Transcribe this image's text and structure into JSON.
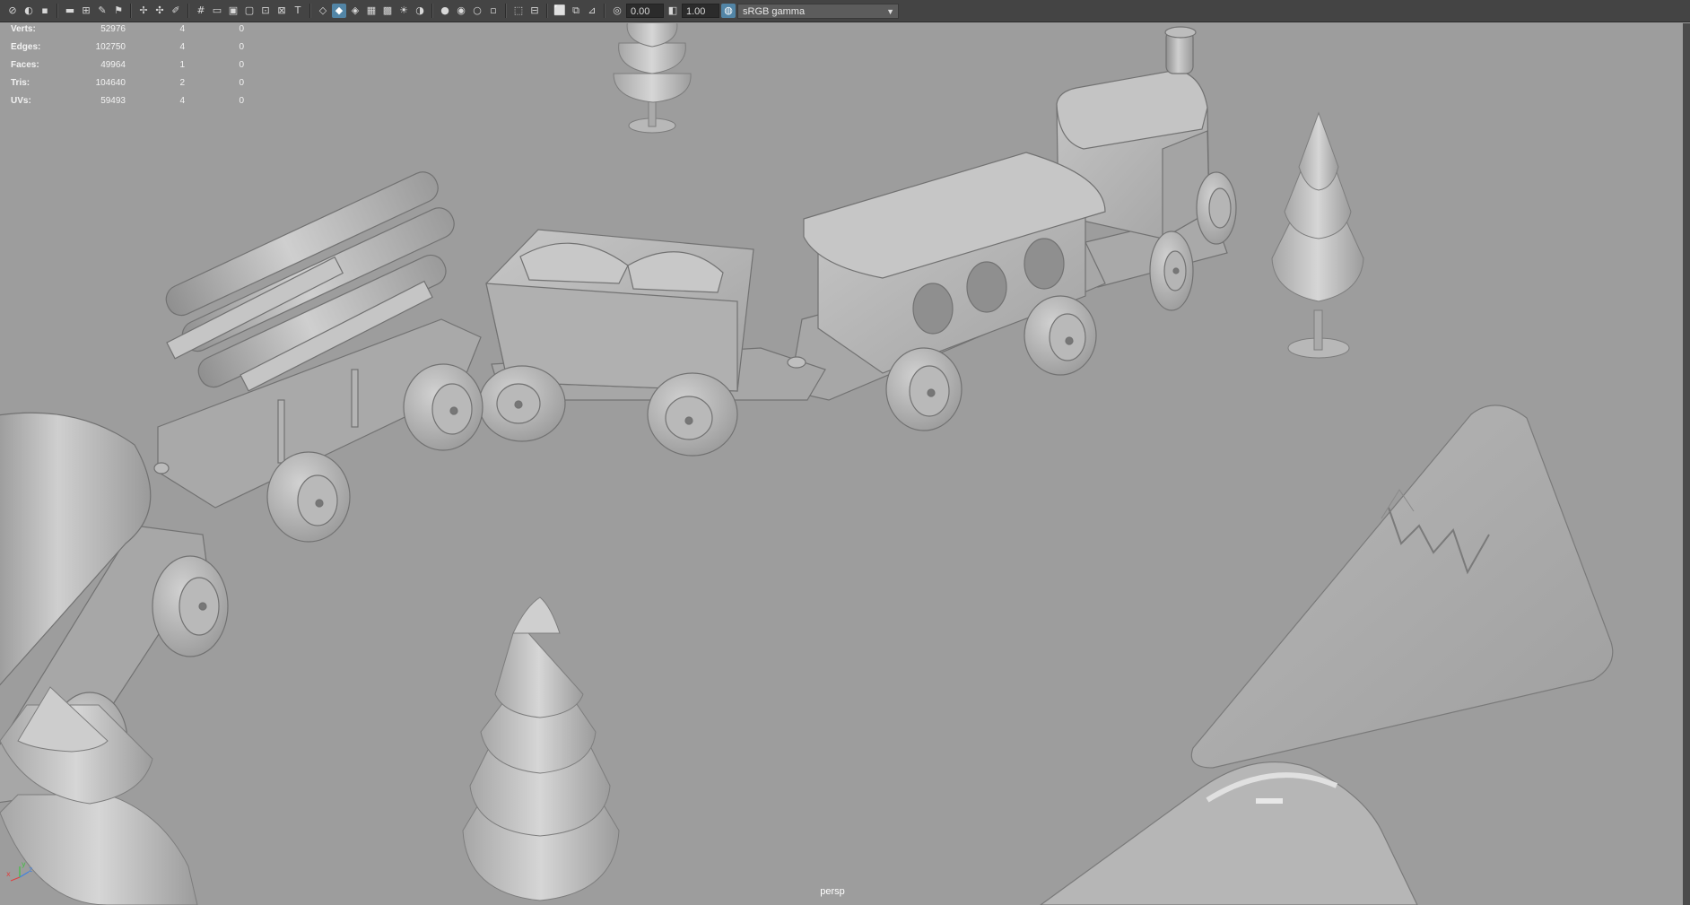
{
  "toolbar": {
    "exposure_value": "0.00",
    "gamma_value": "1.00",
    "color_space": "sRGB gamma"
  },
  "hud": {
    "rows": [
      {
        "label": "Verts:",
        "total": "52976",
        "selected": "4",
        "other": "0"
      },
      {
        "label": "Edges:",
        "total": "102750",
        "selected": "4",
        "other": "0"
      },
      {
        "label": "Faces:",
        "total": "49964",
        "selected": "1",
        "other": "0"
      },
      {
        "label": "Tris:",
        "total": "104640",
        "selected": "2",
        "other": "0"
      },
      {
        "label": "UVs:",
        "total": "59493",
        "selected": "4",
        "other": "0"
      }
    ]
  },
  "viewport": {
    "camera": "persp"
  },
  "axis": {
    "x": "x",
    "y": "y",
    "z": "z"
  },
  "colors": {
    "toolbar_bg": "#444444",
    "viewport_bg": "#9d9d9d",
    "active_icon": "#5285a6",
    "model_fill": "#b4b4b4"
  }
}
